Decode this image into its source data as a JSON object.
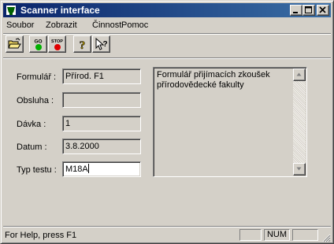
{
  "window": {
    "title": "Scanner interface",
    "icon": "scanner-app-icon",
    "controls": [
      "minimize-icon",
      "maximize-icon",
      "close-icon"
    ]
  },
  "menu": [
    {
      "label": "Soubor"
    },
    {
      "label": "Zobrazit"
    },
    {
      "label": "Činnost"
    },
    {
      "label": "Pomoc"
    }
  ],
  "toolbar": {
    "open_icon": "open-folder-icon",
    "go_label": "GO",
    "stop_label": "STOP",
    "help_icon": "help-question-icon",
    "context_help_icon": "context-help-pointer-icon"
  },
  "form": {
    "formular_label": "Formulář :",
    "formular_value": "Přírod. F1",
    "obsluha_label": "Obsluha :",
    "obsluha_value": "",
    "davka_label": "Dávka :",
    "davka_value": "1",
    "datum_label": "Datum :",
    "datum_value": "3.8.2000",
    "typ_label": "Typ testu :",
    "typ_value": "M18A"
  },
  "memo": {
    "text": "Formulář přijímacích zkoušek přírodovědecké fakulty"
  },
  "status": {
    "help_text": "For Help, press F1",
    "panel_1": "",
    "panel_2": "NUM",
    "panel_3": ""
  },
  "colors": {
    "title_bar": "#0a246a",
    "face": "#d4d0c8",
    "go_green": "#00b000",
    "stop_red": "#e00000"
  }
}
